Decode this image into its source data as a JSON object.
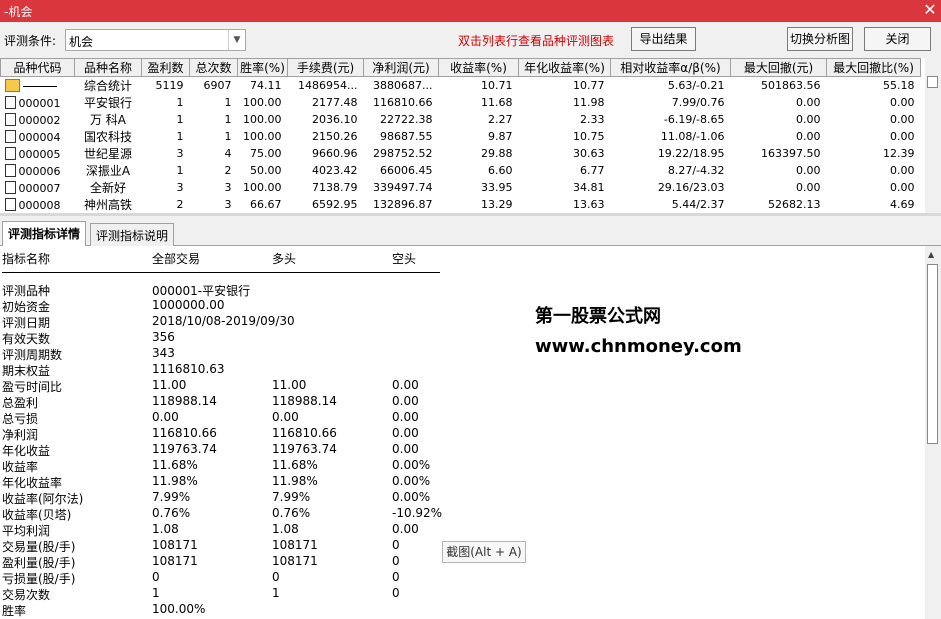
{
  "window": {
    "title": "-机会",
    "close_glyph": "✕"
  },
  "toolbar": {
    "condition_label": "评测条件:",
    "condition_value": "机会",
    "hint": "双击列表行查看品种评测图表",
    "export_button": "导出结果",
    "switch_button": "切换分析图",
    "close_button": "关闭"
  },
  "grid": {
    "columns": [
      "品种代码",
      "品种名称",
      "盈利数",
      "总次数",
      "胜率(%)",
      "手续费(元)",
      "净利润(元)",
      "收益率(%)",
      "年化收益率(%)",
      "相对收益率α/β(%)",
      "最大回撤(元)",
      "最大回撤比(%)"
    ],
    "summary": {
      "name": "综合统计",
      "cells": [
        "5119",
        "6907",
        "74.11",
        "1486954...",
        "3880687...",
        "10.71",
        "10.77",
        "5.63/-0.21",
        "501863.56",
        "55.18"
      ]
    },
    "rows": [
      {
        "code": "000001",
        "name": "平安银行",
        "cells": [
          "1",
          "1",
          "100.00",
          "2177.48",
          "116810.66",
          "11.68",
          "11.98",
          "7.99/0.76",
          "0.00",
          "0.00"
        ]
      },
      {
        "code": "000002",
        "name": "万 科A",
        "cells": [
          "1",
          "1",
          "100.00",
          "2036.10",
          "22722.38",
          "2.27",
          "2.33",
          "-6.19/-8.65",
          "0.00",
          "0.00"
        ]
      },
      {
        "code": "000004",
        "name": "国农科技",
        "cells": [
          "1",
          "1",
          "100.00",
          "2150.26",
          "98687.55",
          "9.87",
          "10.75",
          "11.08/-1.06",
          "0.00",
          "0.00"
        ]
      },
      {
        "code": "000005",
        "name": "世纪星源",
        "cells": [
          "3",
          "4",
          "75.00",
          "9660.96",
          "298752.52",
          "29.88",
          "30.63",
          "19.22/18.95",
          "163397.50",
          "12.39"
        ]
      },
      {
        "code": "000006",
        "name": "深振业A",
        "cells": [
          "1",
          "2",
          "50.00",
          "4023.42",
          "66006.45",
          "6.60",
          "6.77",
          "8.27/-4.32",
          "0.00",
          "0.00"
        ]
      },
      {
        "code": "000007",
        "name": "全新好",
        "cells": [
          "3",
          "3",
          "100.00",
          "7138.79",
          "339497.74",
          "33.95",
          "34.81",
          "29.16/23.03",
          "0.00",
          "0.00"
        ]
      },
      {
        "code": "000008",
        "name": "神州高铁",
        "cells": [
          "2",
          "3",
          "66.67",
          "6592.95",
          "132896.87",
          "13.29",
          "13.63",
          "5.44/2.37",
          "52682.13",
          "4.69"
        ]
      }
    ]
  },
  "tabs": [
    "评测指标详情",
    "评测指标说明"
  ],
  "detail": {
    "headers": [
      "指标名称",
      "全部交易",
      "多头",
      "空头"
    ],
    "rows": [
      [
        "评测品种",
        "000001-平安银行",
        "",
        ""
      ],
      [
        "初始资金",
        "1000000.00",
        "",
        ""
      ],
      [
        "评测日期",
        "2018/10/08-2019/09/30",
        "",
        ""
      ],
      [
        "有效天数",
        "356",
        "",
        ""
      ],
      [
        "评测周期数",
        "343",
        "",
        ""
      ],
      [
        "期末权益",
        "1116810.63",
        "",
        ""
      ],
      [
        "盈亏时间比",
        "11.00",
        "11.00",
        "0.00"
      ],
      [
        "总盈利",
        "118988.14",
        "118988.14",
        "0.00"
      ],
      [
        "总亏损",
        "0.00",
        "0.00",
        "0.00"
      ],
      [
        "净利润",
        "116810.66",
        "116810.66",
        "0.00"
      ],
      [
        "年化收益",
        "119763.74",
        "119763.74",
        "0.00"
      ],
      [
        "收益率",
        "11.68%",
        "11.68%",
        "0.00%"
      ],
      [
        "年化收益率",
        "11.98%",
        "11.98%",
        "0.00%"
      ],
      [
        "收益率(阿尔法)",
        "7.99%",
        "7.99%",
        "0.00%"
      ],
      [
        "收益率(贝塔)",
        "0.76%",
        "0.76%",
        "-10.92%"
      ],
      [
        "平均利润",
        "1.08",
        "1.08",
        "0.00"
      ],
      [
        "交易量(股/手)",
        "108171",
        "108171",
        "0"
      ],
      [
        "盈利量(股/手)",
        "108171",
        "108171",
        "0"
      ],
      [
        "亏损量(股/手)",
        "0",
        "0",
        "0"
      ],
      [
        "交易次数",
        "1",
        "1",
        "0"
      ],
      [
        "胜率",
        "100.00%",
        "",
        ""
      ]
    ],
    "watermark_line1": "第一股票公式网",
    "watermark_line2": "www.chnmoney.com",
    "tooltip": "截图(Alt + A)"
  }
}
